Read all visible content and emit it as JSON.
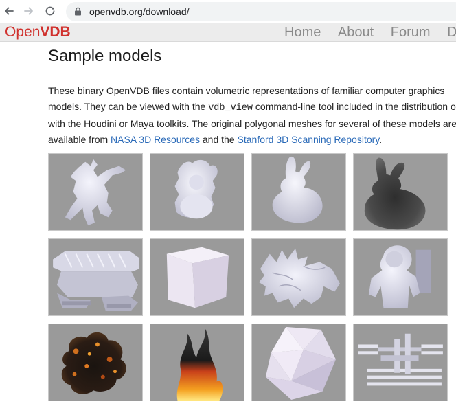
{
  "browser": {
    "url": "openvdb.org/download/"
  },
  "site": {
    "logo_part1": "Open",
    "logo_part2": "VDB",
    "nav": [
      "Home",
      "About",
      "Forum",
      "Do"
    ]
  },
  "content": {
    "title": "Sample models",
    "desc_line1": "These binary OpenVDB files contain volumetric representations of familiar computer graphics",
    "desc_line2_pre": "models. They can be viewed with the ",
    "desc_code": "vdb_view",
    "desc_line2_post": " command-line tool included in the distribution or",
    "desc_line3": "with the Houdini or Maya toolkits. The original polygonal meshes for several of these models are",
    "desc_line4_pre": "available from ",
    "link_nasa": "NASA 3D Resources",
    "desc_line4_mid": " and the ",
    "link_stanford": "Stanford 3D Scanning Repository",
    "desc_line4_post": "."
  },
  "models": [
    {
      "name": "armadillo",
      "icon": "armadillo-model"
    },
    {
      "name": "buddha",
      "icon": "buddha-model"
    },
    {
      "name": "bunny",
      "icon": "bunny-model"
    },
    {
      "name": "bunny-cloud",
      "icon": "bunny-cloud-model"
    },
    {
      "name": "crawler",
      "icon": "crawler-model"
    },
    {
      "name": "cube",
      "icon": "cube-model"
    },
    {
      "name": "dragon",
      "icon": "dragon-model"
    },
    {
      "name": "astronaut",
      "icon": "astronaut-model"
    },
    {
      "name": "explosion",
      "icon": "explosion-model"
    },
    {
      "name": "fire",
      "icon": "fire-model"
    },
    {
      "name": "icosahedron",
      "icon": "icosahedron-model"
    },
    {
      "name": "space-station",
      "icon": "space-station-model"
    }
  ],
  "colors": {
    "logo": "#d0312d",
    "link": "#2a6ab8",
    "tile_bg": "#9a9a9a",
    "model": "#e8e8f4"
  }
}
